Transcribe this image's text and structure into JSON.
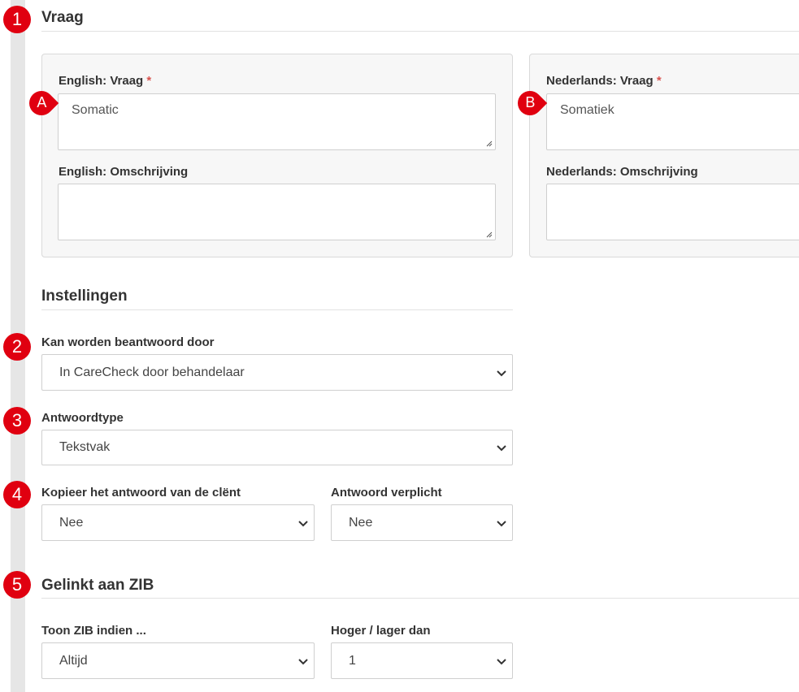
{
  "sections": {
    "vraag_title": "Vraag",
    "instellingen_title": "Instellingen",
    "zib_title": "Gelinkt aan ZIB"
  },
  "english": {
    "question_label": "English: Vraag",
    "question_value": "Somatic",
    "description_label": "English: Omschrijving",
    "description_value": ""
  },
  "dutch": {
    "question_label": "Nederlands: Vraag",
    "question_value": "Somatiek",
    "description_label": "Nederlands: Omschrijving",
    "description_value": ""
  },
  "required_marker": "*",
  "settings": {
    "answered_by_label": "Kan worden beantwoord door",
    "answered_by_value": "In CareCheck door behandelaar",
    "answer_type_label": "Antwoordtype",
    "answer_type_value": "Tekstvak",
    "copy_answer_label": "Kopieer het antwoord van de clënt",
    "copy_answer_value": "Nee",
    "required_answer_label": "Antwoord verplicht",
    "required_answer_value": "Nee"
  },
  "zib": {
    "show_label": "Toon ZIB indien ...",
    "show_value": "Altijd",
    "higher_lower_label": "Hoger / lager dan",
    "higher_lower_value": "1"
  },
  "callouts": {
    "numbers": [
      "1",
      "2",
      "3",
      "4",
      "5"
    ],
    "letters": [
      "A",
      "B"
    ],
    "color": "#e00010"
  },
  "icons": {
    "dropdown": "chevron-down-icon",
    "resize": "resize-grip-icon"
  }
}
